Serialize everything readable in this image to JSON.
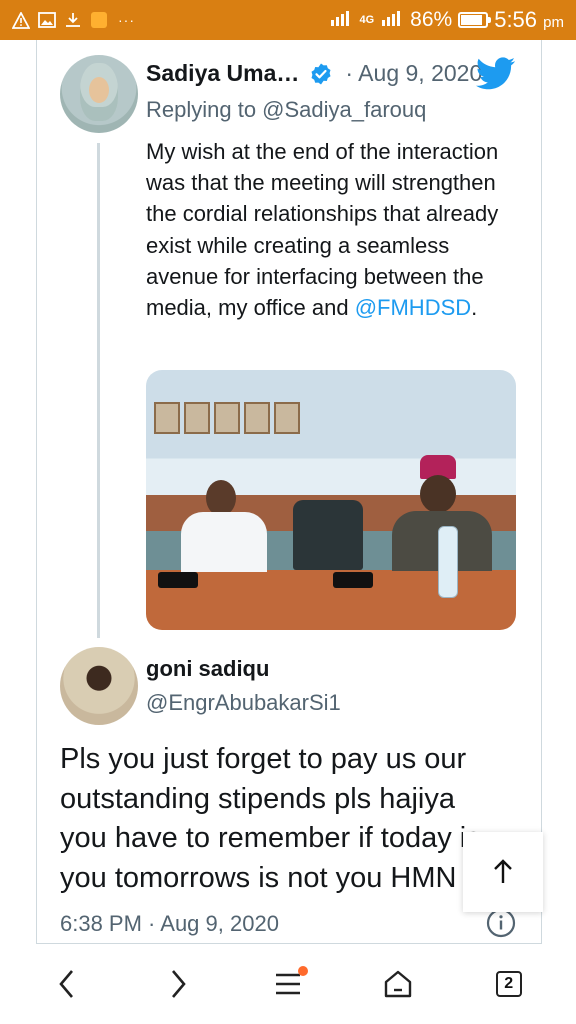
{
  "status_bar": {
    "battery_percent": "86%",
    "battery_level": 0.86,
    "network_label": "4G",
    "time": "5:56",
    "time_suffix": "pm",
    "accent_color": "#d97f12"
  },
  "quoted_tweet": {
    "author_name": "Sadiya Uma…",
    "date": "· Aug 9, 2020",
    "replying_to": "Replying to @Sadiya_farouq",
    "text": "My wish at the end of the interaction was that the meeting will strengthen the cordial relationships that already exist while creating a seamless avenue for interfacing between the media, my office and ",
    "mention": "@FMHDSD",
    "text_end": "."
  },
  "reply_tweet": {
    "author_name": "goni sadiqu",
    "handle": "@EngrAbubakarSi1",
    "text": "Pls you just forget to pay us our\noutstanding stipends pls hajiya\nyou have to remember if today is\nyou tomorrows is not you HMN",
    "time": "6:38 PM · Aug 9, 2020"
  },
  "bottom_nav": {
    "tabs_count": "2"
  },
  "icons": {
    "verified": "verified-badge-icon",
    "twitter": "twitter-bird-icon",
    "info": "info-icon",
    "scroll_top": "arrow-up-icon",
    "back": "chevron-left-icon",
    "forward": "chevron-right-icon",
    "menu": "menu-icon",
    "home": "home-icon"
  }
}
